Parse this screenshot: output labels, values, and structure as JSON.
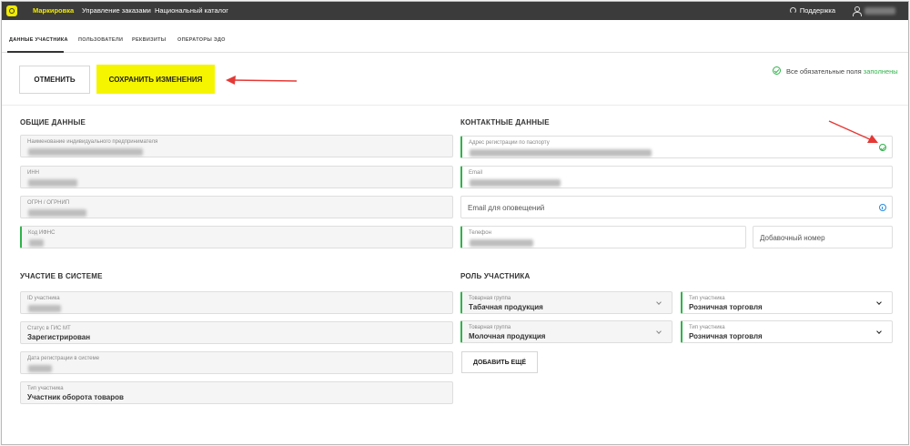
{
  "topbar": {
    "nav": [
      "Маркировка",
      "Управление заказами",
      "Национальный каталог"
    ],
    "support_label": "Поддержка"
  },
  "tabs": [
    "Данные участника",
    "Пользователи",
    "Реквизиты",
    "Операторы ЭДО"
  ],
  "actions": {
    "cancel_label": "Отменить",
    "save_label": "Сохранить изменения"
  },
  "status": {
    "text": "Все обязательные поля",
    "link": "заполнены"
  },
  "general": {
    "title": "Общие данные",
    "fields": [
      {
        "label": "Наименование индивидуального предпринимателя"
      },
      {
        "label": "ИНН"
      },
      {
        "label": "ОГРН / ОГРНИП"
      },
      {
        "label": "Код ИФНС"
      }
    ]
  },
  "contacts": {
    "title": "Контактные данные",
    "fields": [
      {
        "label": "Адрес регистрации по паспорту"
      },
      {
        "label": "Email"
      },
      {
        "placeholder": "Email для оповещений"
      },
      {
        "label": "Телефон"
      },
      {
        "placeholder": "Добавочный номер"
      }
    ]
  },
  "system": {
    "title": "Участие в системе",
    "fields": [
      {
        "label": "ID участника",
        "value": ""
      },
      {
        "label": "Статус в ГИС МТ",
        "value": "Зарегистрирован"
      },
      {
        "label": "Дата регистрации в системе",
        "value": ""
      },
      {
        "label": "Тип участника",
        "value": "Участник оборота товаров"
      }
    ]
  },
  "role": {
    "title": "Роль участника",
    "rows": [
      {
        "group_label": "Товарная группа",
        "group_value": "Табачная продукция",
        "type_label": "Тип участника",
        "type_value": "Розничная торговля"
      },
      {
        "group_label": "Товарная группа",
        "group_value": "Молочная продукция",
        "type_label": "Тип участника",
        "type_value": "Розничная торговля"
      }
    ],
    "add_label": "Добавить ещё"
  },
  "colors": {
    "accent": "#f5f500",
    "success": "#2fb34a",
    "info": "#2a8be0",
    "annotation": "#e53935",
    "topbar": "#3b3b3b"
  }
}
